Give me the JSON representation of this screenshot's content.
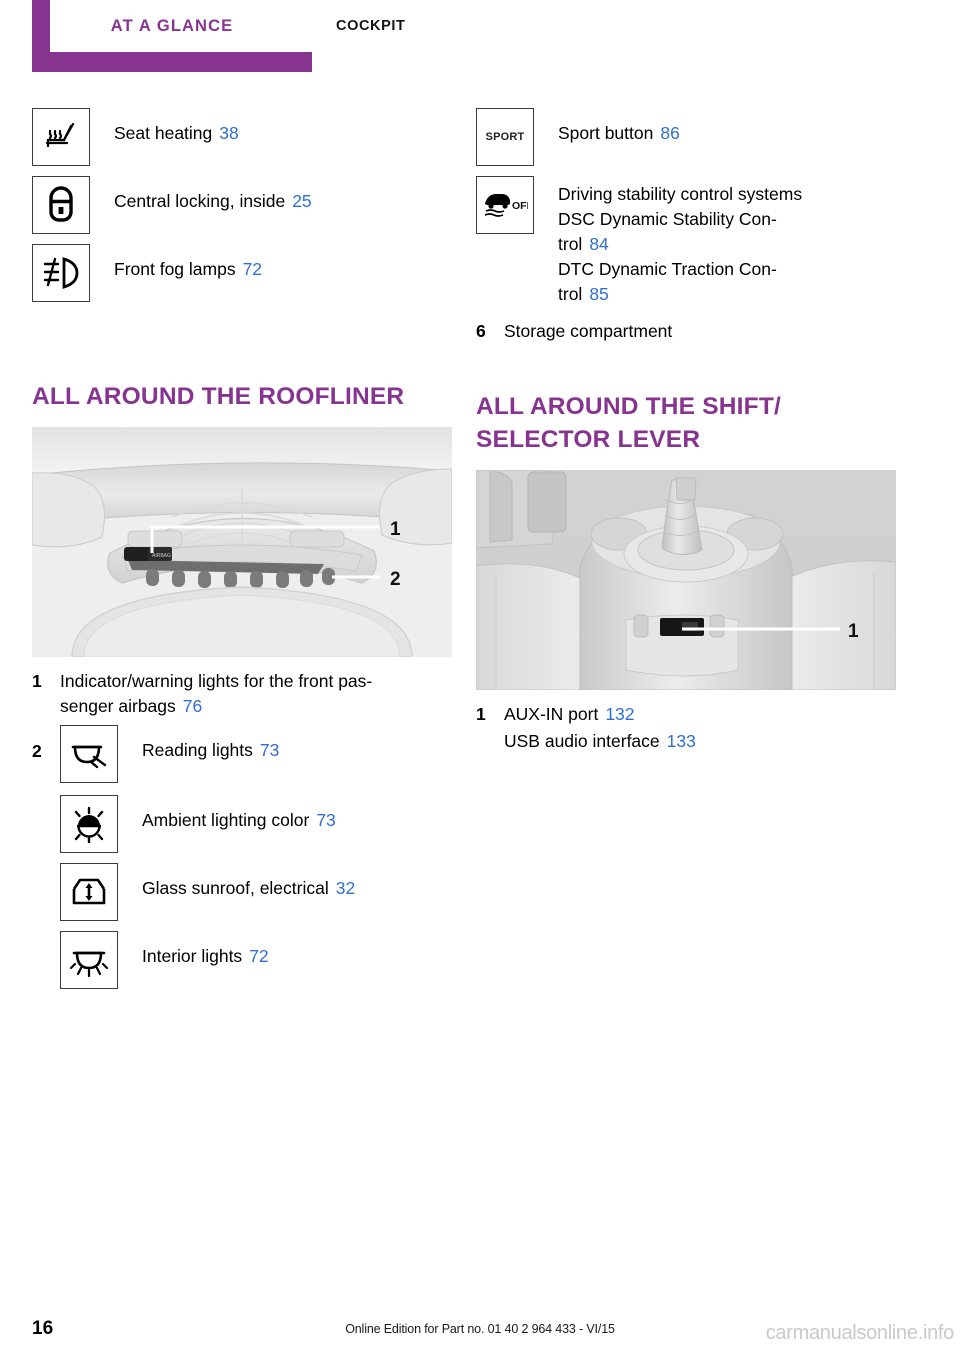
{
  "header": {
    "tab_label": "AT A GLANCE",
    "section_label": "COCKPIT",
    "accent_color": "#86348f"
  },
  "colors": {
    "purple": "#86348f",
    "page_link_blue": "#2f6fd0",
    "figure_background": "#f0f0f0"
  },
  "left_column": {
    "icon_entries": [
      {
        "icon": "seat-heating-icon",
        "label": "Seat heating",
        "page": "38"
      },
      {
        "icon": "central-locking-icon",
        "label": "Central locking, inside",
        "page": "25"
      },
      {
        "icon": "front-fog-lamp-icon",
        "label": "Front fog lamps",
        "page": "72"
      }
    ],
    "section": {
      "heading": "ALL AROUND THE ROOFLINER",
      "figure_name": "roofliner-illustration",
      "figure_callouts": [
        "1",
        "2"
      ],
      "items": [
        {
          "marker": "1",
          "text": "Indicator/warning lights for the front pas-senger airbags",
          "text_line1": "Indicator/warning lights for the front pas-",
          "text_line2": "senger airbags",
          "page": "76"
        },
        {
          "marker": "2",
          "icon": "reading-lights-icon",
          "label": "Reading lights",
          "page": "73"
        },
        {
          "marker": "",
          "icon": "ambient-lighting-icon",
          "label": "Ambient lighting color",
          "page": "73"
        },
        {
          "marker": "",
          "icon": "glass-sunroof-icon",
          "label": "Glass sunroof, electrical",
          "page": "32"
        },
        {
          "marker": "",
          "icon": "interior-lights-icon",
          "label": "Interior lights",
          "page": "72"
        }
      ]
    }
  },
  "right_column": {
    "icon_entries": [
      {
        "icon": "sport-button-icon",
        "label": "Sport button",
        "page": "86"
      }
    ],
    "dsc_entry": {
      "icon": "dsc-off-icon",
      "title": "Driving stability control systems",
      "lines": [
        {
          "text_line1": "DSC Dynamic Stability Con-",
          "text_line2": "trol",
          "page": "84"
        },
        {
          "text_line1": "DTC Dynamic Traction Con-",
          "text_line2": "trol",
          "page": "85"
        }
      ]
    },
    "storage_item": {
      "marker": "6",
      "text": "Storage compartment"
    },
    "section": {
      "heading_line1": "ALL AROUND THE SHIFT/",
      "heading_line2": "SELECTOR LEVER",
      "figure_name": "shift-selector-lever-illustration",
      "figure_callouts": [
        "1"
      ],
      "items": [
        {
          "marker": "1",
          "label": "AUX-IN port",
          "page": "132"
        },
        {
          "marker": "",
          "label": "USB audio interface",
          "page": "133"
        }
      ]
    }
  },
  "footer": {
    "page_number": "16",
    "edition_text": "Online Edition for Part no. 01 40 2 964 433 - VI/15",
    "watermark": "carmanualsonline.info"
  }
}
